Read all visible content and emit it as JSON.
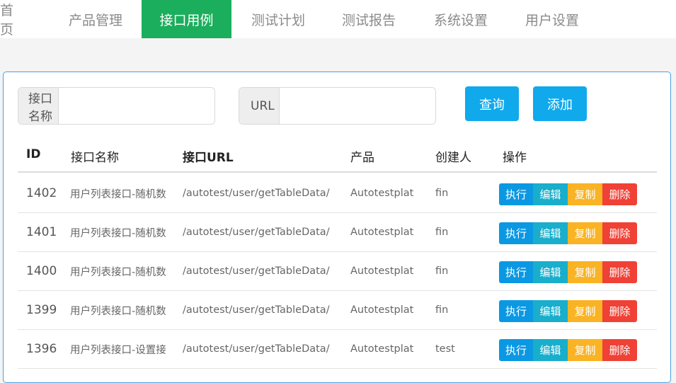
{
  "nav": {
    "items": [
      {
        "label": "首 页",
        "active": false
      },
      {
        "label": "产品管理",
        "active": false
      },
      {
        "label": "接口用例",
        "active": true
      },
      {
        "label": "测试计划",
        "active": false
      },
      {
        "label": "测试报告",
        "active": false
      },
      {
        "label": "系统设置",
        "active": false
      },
      {
        "label": "用户设置",
        "active": false
      }
    ],
    "active_color": "#1bae5c"
  },
  "search": {
    "name_label": "接口名称",
    "name_value": "",
    "url_label": "URL",
    "url_value": "",
    "query_button": "查询",
    "add_button": "添加"
  },
  "table": {
    "headers": [
      "ID",
      "接口名称",
      "接口URL",
      "产品",
      "创建人",
      "操作"
    ],
    "actions": {
      "execute": "执行",
      "edit": "编辑",
      "copy": "复制",
      "delete": "删除"
    },
    "rows": [
      {
        "id": "1402",
        "name": "用户列表接口-随机数",
        "url": "/autotest/user/getTableData/",
        "product": "Autotestplat",
        "creator": "fin"
      },
      {
        "id": "1401",
        "name": "用户列表接口-随机数",
        "url": "/autotest/user/getTableData/",
        "product": "Autotestplat",
        "creator": "fin"
      },
      {
        "id": "1400",
        "name": "用户列表接口-随机数",
        "url": "/autotest/user/getTableData/",
        "product": "Autotestplat",
        "creator": "fin"
      },
      {
        "id": "1399",
        "name": "用户列表接口-随机数",
        "url": "/autotest/user/getTableData/",
        "product": "Autotestplat",
        "creator": "fin"
      },
      {
        "id": "1396",
        "name": "用户列表接口-设置接",
        "url": "/autotest/user/getTableData/",
        "product": "Autotestplat",
        "creator": "test"
      }
    ]
  },
  "colors": {
    "primary_blue": "#0fa9ec",
    "execute": "#0b98e3",
    "edit": "#19aecb",
    "copy": "#f9b324",
    "delete": "#f04136"
  }
}
